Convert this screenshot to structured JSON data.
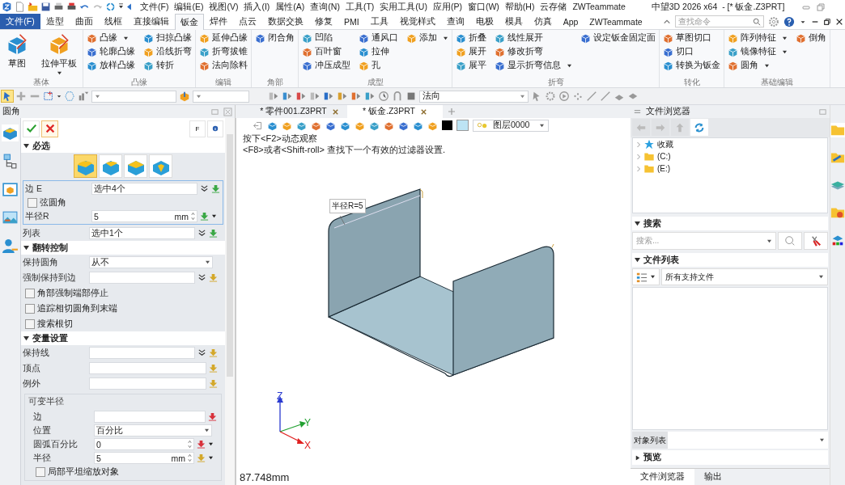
{
  "menu_bar": [
    "文件(F)",
    "编辑(E)",
    "视图(V)",
    "插入(I)",
    "属性(A)",
    "查询(N)",
    "工具(T)",
    "实用工具(U)",
    "应用(P)",
    "窗口(W)",
    "帮助(H)",
    "云存储",
    "ZWTeammate"
  ],
  "window": {
    "title": "中望3D 2026 x64  - [* 钣金.Z3PRT]"
  },
  "ribbon": {
    "tabs": [
      {
        "label": "文件(F)",
        "kind": "file",
        "selected": false
      },
      {
        "label": "造型",
        "kind": "tab",
        "selected": false
      },
      {
        "label": "曲面",
        "kind": "tab",
        "selected": false
      },
      {
        "label": "线框",
        "kind": "tab",
        "selected": false
      },
      {
        "label": "直接编辑",
        "kind": "tab",
        "selected": false
      },
      {
        "label": "钣金",
        "kind": "tab",
        "selected": true
      },
      {
        "label": "焊件",
        "kind": "tab",
        "selected": false
      },
      {
        "label": "点云",
        "kind": "tab",
        "selected": false
      },
      {
        "label": "数据交换",
        "kind": "tab",
        "selected": false
      },
      {
        "label": "修复",
        "kind": "tab",
        "selected": false
      },
      {
        "label": "PMI",
        "kind": "tab",
        "selected": false
      },
      {
        "label": "工具",
        "kind": "tab",
        "selected": false
      },
      {
        "label": "视觉样式",
        "kind": "tab",
        "selected": false
      },
      {
        "label": "查询",
        "kind": "tab",
        "selected": false
      },
      {
        "label": "电极",
        "kind": "tab",
        "selected": false
      },
      {
        "label": "模具",
        "kind": "tab",
        "selected": false
      },
      {
        "label": "仿真",
        "kind": "tab",
        "selected": false
      },
      {
        "label": "App",
        "kind": "tab",
        "selected": false
      },
      {
        "label": "ZWTeammate",
        "kind": "tab",
        "selected": false
      }
    ],
    "search": {
      "placeholder": "查找命令"
    },
    "groups": [
      {
        "label": "基体",
        "columns": [
          [
            {
              "label": "草图",
              "kind": "large",
              "dropdown": false
            }
          ],
          [
            {
              "label": "拉伸平板",
              "kind": "large",
              "dropdown": true
            }
          ]
        ]
      },
      {
        "label": "凸缘",
        "columns": [
          [
            {
              "label": "凸缘",
              "kind": "small",
              "dropdown": true
            },
            {
              "label": "轮廓凸缘",
              "kind": "small",
              "dropdown": false
            },
            {
              "label": "放样凸缘",
              "kind": "small",
              "dropdown": false
            }
          ],
          [
            {
              "label": "扫掠凸缘",
              "kind": "small",
              "dropdown": false
            },
            {
              "label": "沿线折弯",
              "kind": "small",
              "dropdown": false
            },
            {
              "label": "转折",
              "kind": "small",
              "dropdown": false
            }
          ]
        ]
      },
      {
        "label": "编辑",
        "columns": [
          [
            {
              "label": "延伸凸缘",
              "kind": "small",
              "dropdown": false
            },
            {
              "label": "折弯拔锥",
              "kind": "small",
              "dropdown": false
            },
            {
              "label": "法向除料",
              "kind": "small",
              "dropdown": false
            }
          ]
        ]
      },
      {
        "label": "角部",
        "columns": [
          [
            {
              "label": "闭合角",
              "kind": "small",
              "dropdown": false
            }
          ]
        ]
      },
      {
        "label": "成型",
        "columns": [
          [
            {
              "label": "凹陷",
              "kind": "small",
              "dropdown": false
            },
            {
              "label": "百叶窗",
              "kind": "small",
              "dropdown": false
            },
            {
              "label": "冲压成型",
              "kind": "small",
              "dropdown": false
            }
          ],
          [
            {
              "label": "通风口",
              "kind": "small",
              "dropdown": false
            },
            {
              "label": "拉伸",
              "kind": "small",
              "dropdown": false
            },
            {
              "label": "孔",
              "kind": "small",
              "dropdown": false
            }
          ],
          [
            {
              "label": "添加",
              "kind": "small",
              "dropdown": true
            }
          ]
        ]
      },
      {
        "label": "折弯",
        "columns": [
          [
            {
              "label": "折叠",
              "kind": "small",
              "dropdown": false
            },
            {
              "label": "展开",
              "kind": "small",
              "dropdown": false
            },
            {
              "label": "展平",
              "kind": "small",
              "dropdown": false
            }
          ],
          [
            {
              "label": "线性展开",
              "kind": "small",
              "dropdown": false
            },
            {
              "label": "修改折弯",
              "kind": "small",
              "dropdown": false
            },
            {
              "label": "显示折弯信息",
              "kind": "small",
              "dropdown": true
            }
          ],
          [
            {
              "label": "设定钣金固定面",
              "kind": "small",
              "dropdown": false
            }
          ]
        ]
      },
      {
        "label": "转化",
        "columns": [
          [
            {
              "label": "草图切口",
              "kind": "small",
              "dropdown": false
            },
            {
              "label": "切口",
              "kind": "small",
              "dropdown": false
            },
            {
              "label": "转换为钣金",
              "kind": "small",
              "dropdown": false
            }
          ]
        ]
      },
      {
        "label": "基础编辑",
        "columns": [
          [
            {
              "label": "阵列特征",
              "kind": "small",
              "dropdown": true
            },
            {
              "label": "镜像特征",
              "kind": "small",
              "dropdown": true
            },
            {
              "label": "圆角",
              "kind": "small",
              "dropdown": true
            }
          ],
          [
            {
              "label": "倒角",
              "kind": "small",
              "dropdown": false
            }
          ]
        ]
      }
    ]
  },
  "toolbar": {
    "pick_direction": "法向"
  },
  "document_tabs": [
    {
      "label": "* 零件001.Z3PRT",
      "selected": false
    },
    {
      "label": "* 钣金.Z3PRT",
      "selected": true
    }
  ],
  "fillet_panel": {
    "title": "圆角",
    "buttons": [
      "F"
    ],
    "sections": [
      {
        "title": "必选",
        "expanded": true,
        "options": [
          {
            "selected": true
          },
          {
            "selected": false
          },
          {
            "selected": false
          },
          {
            "selected": false
          }
        ],
        "items": [
          {
            "kind": "box",
            "rows": [
              {
                "kind": "field",
                "label": "边 E",
                "value": "选中4个",
                "multi": true,
                "color": "#3aa845"
              },
              {
                "kind": "checkbox",
                "label": "弦圆角",
                "checked": false
              },
              {
                "kind": "spinner",
                "label": "半径R",
                "value": "5",
                "unit": "mm",
                "color": "#3aa845"
              }
            ]
          },
          {
            "kind": "field",
            "label": "列表",
            "value": "选中1个",
            "multi": true,
            "color": "#3aa845"
          }
        ]
      },
      {
        "title": "翻转控制",
        "expanded": true,
        "items": [
          {
            "kind": "select",
            "label": "保持圆角",
            "value": "从不"
          },
          {
            "kind": "field",
            "label": "强制保持到边",
            "multi": true,
            "color": "#d4a82a"
          },
          {
            "kind": "checkbox",
            "label": "角部强制端部停止",
            "checked": false
          },
          {
            "kind": "checkbox",
            "label": "追踪相切圆角到末端",
            "checked": false
          },
          {
            "kind": "checkbox",
            "label": "搜索根切",
            "checked": false
          }
        ]
      },
      {
        "title": "变量设置",
        "expanded": true,
        "items": [
          {
            "kind": "field",
            "label": "保持线",
            "multi": true,
            "color": "#d4a82a"
          },
          {
            "kind": "field",
            "label": "顶点",
            "multi": false,
            "color": "#d4a82a"
          },
          {
            "kind": "field",
            "label": "例外",
            "multi": false,
            "color": "#d4a82a"
          },
          {
            "kind": "box",
            "title": "可变半径",
            "rows": [
              {
                "kind": "field",
                "label": "边",
                "multi": false,
                "color": "#d8323c"
              },
              {
                "kind": "select",
                "label": "位置",
                "value": "百分比"
              },
              {
                "kind": "spinner",
                "label": "圆弧百分比",
                "value": "0",
                "color": "#d8323c"
              },
              {
                "kind": "spinner",
                "label": "半径",
                "value": "5",
                "unit": "mm",
                "color": "#d4a82a"
              },
              {
                "kind": "checkbox",
                "label": "局部平坦缩放对象",
                "checked": false
              }
            ]
          }
        ]
      }
    ]
  },
  "viewport": {
    "layer": "图层0000",
    "hints": [
      "按下<F2>动态观察",
      "<F8>或者<Shift-roll> 查找下一个有效的过滤器设置."
    ],
    "dimension_label": "半径R=5",
    "axes": [
      "X",
      "Y",
      "Z"
    ],
    "status": "87.748mm"
  },
  "file_browser": {
    "title": "文件浏览器",
    "tree": [
      {
        "label": "收藏",
        "kind": "favorites",
        "expanded": false
      },
      {
        "label": "(C:)",
        "kind": "drive",
        "expanded": false
      },
      {
        "label": "(E:)",
        "kind": "drive",
        "expanded": false
      }
    ],
    "sections": [
      {
        "title": "搜索",
        "expanded": true,
        "kind": "search",
        "placeholder": "搜索..."
      },
      {
        "title": "文件列表",
        "expanded": true,
        "kind": "files",
        "filter": "所有支持文件"
      }
    ],
    "object_list": {
      "label": "对象列表"
    },
    "preview": {
      "title": "预览",
      "expanded": false
    },
    "tabs": [
      {
        "label": "文件浏览器",
        "selected": true
      },
      {
        "label": "输出",
        "selected": false
      }
    ]
  }
}
